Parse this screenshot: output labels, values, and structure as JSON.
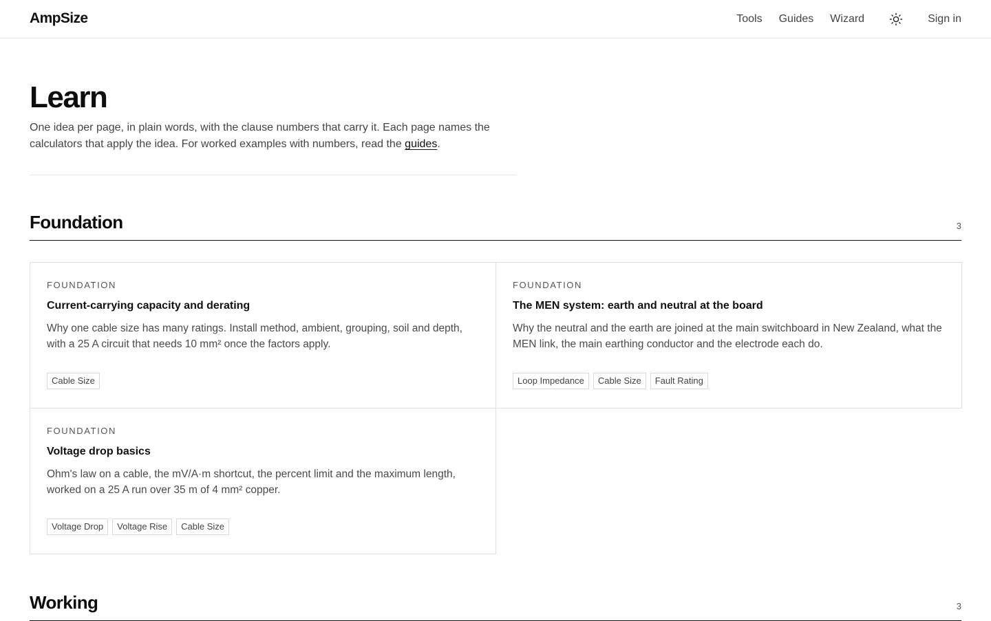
{
  "header": {
    "logo": "AmpSize",
    "nav": [
      "Tools",
      "Guides",
      "Wizard"
    ],
    "sign_in": "Sign in"
  },
  "page": {
    "title": "Learn",
    "intro_text": "One idea per page, in plain words, with the clause numbers that carry it. Each page names the calculators that apply the idea. For worked examples with numbers, read the ",
    "intro_link": "guides",
    "intro_end": "."
  },
  "sections": [
    {
      "title": "Foundation",
      "count": "3",
      "cards": [
        {
          "kicker": "FOUNDATION",
          "title": "Current-carrying capacity and derating",
          "desc": "Why one cable size has many ratings. Install method, ambient, grouping, soil and depth, with a 25 A circuit that needs 10 mm² once the factors apply.",
          "tags": [
            "Cable Size"
          ]
        },
        {
          "kicker": "FOUNDATION",
          "title": "The MEN system: earth and neutral at the board",
          "desc": "Why the neutral and the earth are joined at the main switchboard in New Zealand, what the MEN link, the main earthing conductor and the electrode each do.",
          "tags": [
            "Loop Impedance",
            "Cable Size",
            "Fault Rating"
          ]
        },
        {
          "kicker": "FOUNDATION",
          "title": "Voltage drop basics",
          "desc": "Ohm's law on a cable, the mV/A·m shortcut, the percent limit and the maximum length, worked on a 25 A run over 35 m of 4 mm² copper.",
          "tags": [
            "Voltage Drop",
            "Voltage Rise",
            "Cable Size"
          ]
        }
      ]
    },
    {
      "title": "Working",
      "count": "3"
    }
  ]
}
